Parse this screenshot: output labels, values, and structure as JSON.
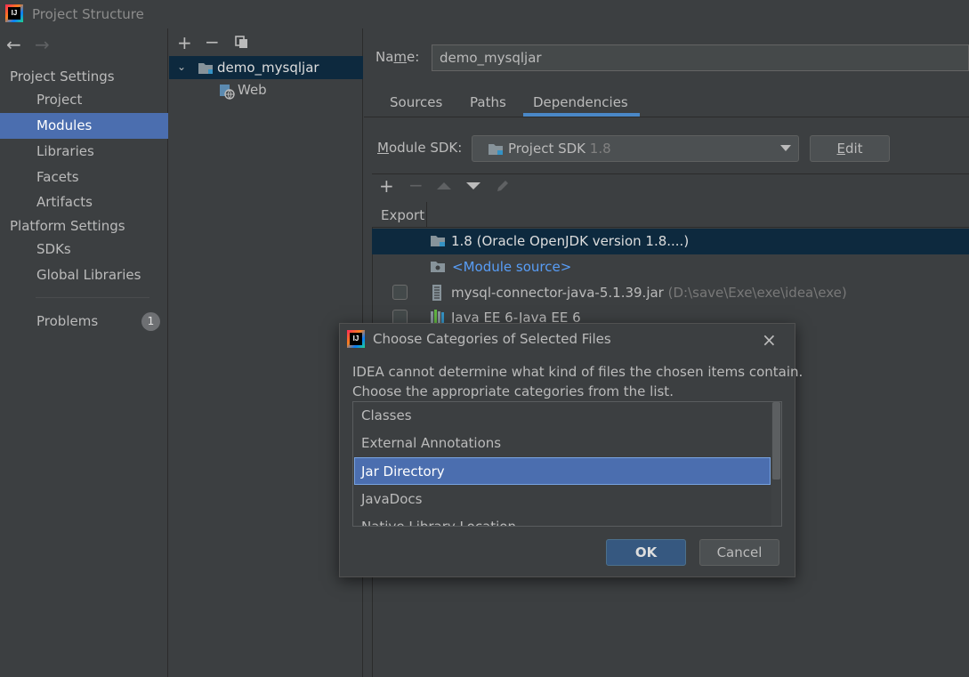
{
  "window": {
    "title": "Project Structure"
  },
  "sidebar": {
    "project_settings_title": "Project Settings",
    "items": [
      "Project",
      "Modules",
      "Libraries",
      "Facets",
      "Artifacts"
    ],
    "platform_settings_title": "Platform Settings",
    "platform_items": [
      "SDKs",
      "Global Libraries"
    ],
    "problems_label": "Problems",
    "problems_count": "1"
  },
  "tree": {
    "module_name": "demo_mysqljar",
    "facet_name": "Web"
  },
  "module": {
    "name_label_pre": "Na",
    "name_label_mnemonic": "m",
    "name_label_post": "e:",
    "name_value": "demo_mysqljar",
    "tabs": [
      "Sources",
      "Paths",
      "Dependencies"
    ],
    "active_tab": "Dependencies",
    "sdk_label_mnemonic": "M",
    "sdk_label_rest": "odule SDK:",
    "sdk_value": "Project SDK",
    "sdk_version": "1.8",
    "edit_mnemonic": "E",
    "edit_rest": "dit"
  },
  "dependencies": {
    "header_export": "Export",
    "rows": [
      {
        "name": "1.8 (Oracle OpenJDK version 1.8....)",
        "path": ""
      },
      {
        "name": "<Module source>",
        "path": ""
      },
      {
        "name": "mysql-connector-java-5.1.39.jar",
        "path": "(D:\\save\\Exe\\exe\\idea\\exe)"
      },
      {
        "name": "Java EE 6-Java EE 6",
        "path": ""
      }
    ]
  },
  "dialog": {
    "title": "Choose Categories of Selected Files",
    "message_line1": "IDEA cannot determine what kind of files the chosen items contain.",
    "message_line2": "Choose the appropriate categories from the list.",
    "options": [
      "Classes",
      "External Annotations",
      "Jar Directory",
      "JavaDocs",
      "Native Library Location"
    ],
    "selected_option": "Jar Directory",
    "ok_label": "OK",
    "cancel_label": "Cancel"
  },
  "colors": {
    "selection": "#4b6eaf",
    "link": "#589df6",
    "background": "#3c3f41"
  }
}
